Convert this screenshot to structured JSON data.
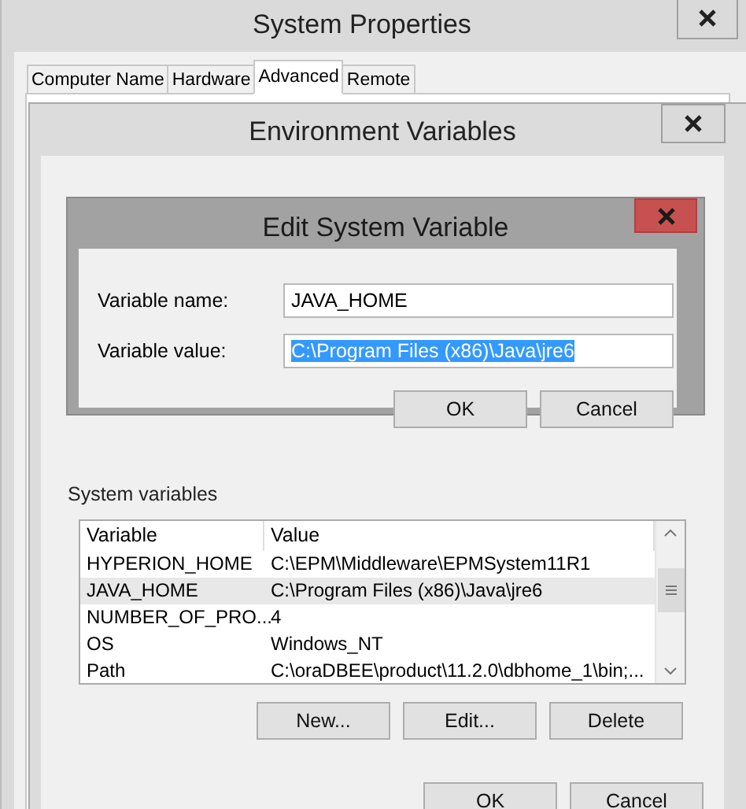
{
  "system_properties": {
    "title": "System Properties",
    "tabs": [
      {
        "label": "Computer Name",
        "selected": false
      },
      {
        "label": "Hardware",
        "selected": false
      },
      {
        "label": "Advanced",
        "selected": true
      },
      {
        "label": "Remote",
        "selected": false
      }
    ]
  },
  "environment_variables": {
    "title": "Environment Variables",
    "system_variables_label": "System variables",
    "table": {
      "columns": [
        "Variable",
        "Value"
      ],
      "rows": [
        {
          "variable": "HYPERION_HOME",
          "value": "C:\\EPM\\Middleware\\EPMSystem11R1",
          "selected": false
        },
        {
          "variable": "JAVA_HOME",
          "value": "C:\\Program Files (x86)\\Java\\jre6",
          "selected": true
        },
        {
          "variable": "NUMBER_OF_PRO...",
          "value": "4",
          "selected": false
        },
        {
          "variable": "OS",
          "value": "Windows_NT",
          "selected": false
        },
        {
          "variable": "Path",
          "value": "C:\\oraDBEE\\product\\11.2.0\\dbhome_1\\bin;...",
          "selected": false
        }
      ]
    },
    "buttons": [
      "New...",
      "Edit...",
      "Delete"
    ],
    "dialog_buttons": [
      "OK",
      "Cancel"
    ]
  },
  "edit_dialog": {
    "title": "Edit System Variable",
    "fields": [
      {
        "label": "Variable name:",
        "value": "JAVA_HOME",
        "selected": false
      },
      {
        "label": "Variable value:",
        "value": "C:\\Program Files (x86)\\Java\\jre6",
        "selected": true
      }
    ],
    "buttons": [
      "OK",
      "Cancel"
    ]
  }
}
